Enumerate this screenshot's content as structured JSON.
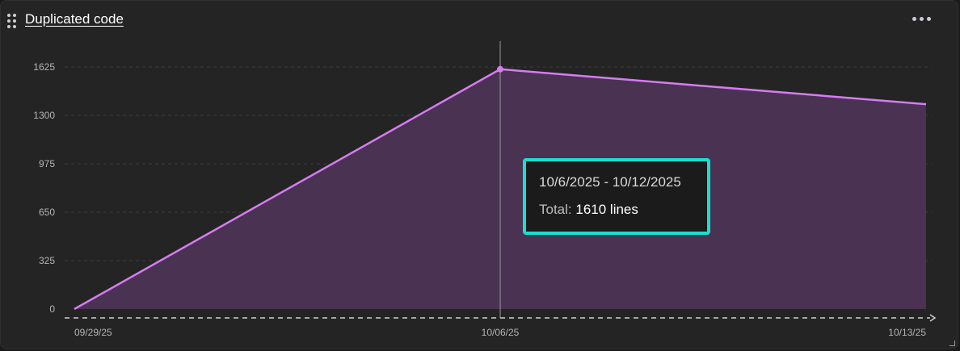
{
  "widget": {
    "title": "Duplicated code",
    "drag_icon": "drag-handle-icon",
    "menu_icon": "more-horizontal-icon"
  },
  "colors": {
    "line": "#d67cf2",
    "area": "#4a3252",
    "tooltip_border": "#16e0cf",
    "background": "#242424"
  },
  "chart_data": {
    "type": "area",
    "x": [
      "09/29/25",
      "10/06/25",
      "10/13/25"
    ],
    "series": [
      {
        "values": [
          0,
          1610,
          1375
        ]
      }
    ],
    "ylim": [
      0,
      1625
    ],
    "yticks": [
      0,
      325,
      650,
      975,
      1300,
      1625
    ],
    "grid": true,
    "hover_index": 1
  },
  "tooltip": {
    "range": "10/6/2025 - 10/12/2025",
    "total_label": "Total:",
    "total_value": "1610 lines"
  }
}
